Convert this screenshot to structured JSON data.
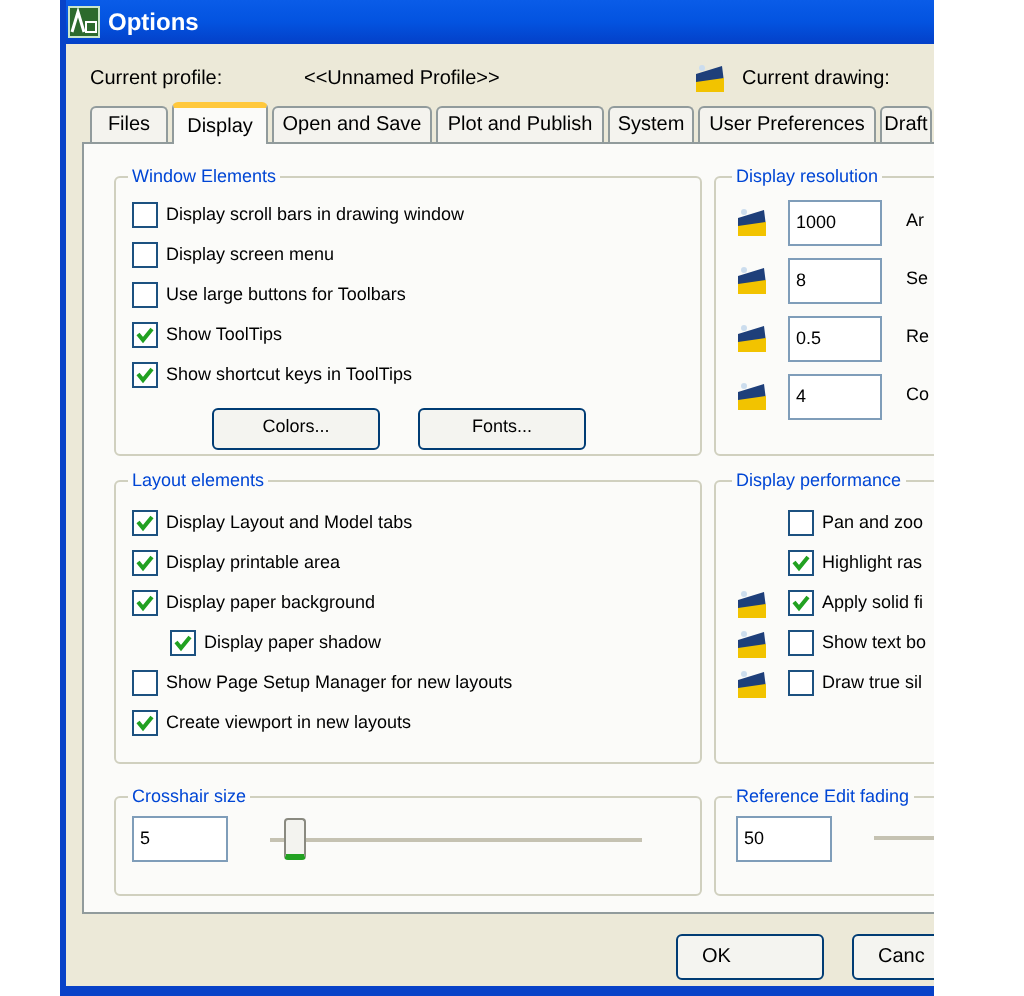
{
  "window": {
    "title": "Options"
  },
  "profile": {
    "current_profile_label": "Current profile:",
    "current_profile": "<<Unnamed Profile>>",
    "current_drawing_label": "Current drawing:"
  },
  "tabs": [
    {
      "label": "Files",
      "selected": false
    },
    {
      "label": "Display",
      "selected": true
    },
    {
      "label": "Open and Save",
      "selected": false
    },
    {
      "label": "Plot and Publish",
      "selected": false
    },
    {
      "label": "System",
      "selected": false
    },
    {
      "label": "User Preferences",
      "selected": false
    },
    {
      "label": "Draft",
      "selected": false
    }
  ],
  "window_elements": {
    "title": "Window Elements",
    "options": [
      {
        "label": "Display scroll bars in drawing window",
        "checked": false
      },
      {
        "label": "Display screen menu",
        "checked": false
      },
      {
        "label": "Use large buttons for Toolbars",
        "checked": false
      },
      {
        "label": "Show ToolTips",
        "checked": true
      },
      {
        "label": "Show shortcut keys in ToolTips",
        "checked": true
      }
    ],
    "buttons": [
      "Colors...",
      "Fonts..."
    ]
  },
  "layout_elements": {
    "title": "Layout elements",
    "options": [
      {
        "label": "Display Layout and Model tabs",
        "checked": true
      },
      {
        "label": "Display printable area",
        "checked": true
      },
      {
        "label": "Display paper background",
        "checked": true,
        "children": [
          {
            "label": "Display paper shadow",
            "checked": true
          }
        ]
      },
      {
        "label": "Show Page Setup Manager for new layouts",
        "checked": false
      },
      {
        "label": "Create viewport in new layouts",
        "checked": true
      }
    ]
  },
  "crosshair_size": {
    "title": "Crosshair size",
    "value": "5",
    "level": 0.04
  },
  "display_resolution": {
    "title": "Display resolution",
    "fields": [
      {
        "value": "1000",
        "label": "Ar",
        "saved_in_drawing": true
      },
      {
        "value": "8",
        "label": "Se",
        "saved_in_drawing": true
      },
      {
        "value": "0.5",
        "label": "Re",
        "saved_in_drawing": true
      },
      {
        "value": "4",
        "label": "Co",
        "saved_in_drawing": true
      }
    ]
  },
  "display_performance": {
    "title": "Display performance",
    "options": [
      {
        "label": "Pan and zoo",
        "checked": false,
        "saved_in_drawing": false
      },
      {
        "label": "Highlight ras",
        "checked": true,
        "saved_in_drawing": false
      },
      {
        "label": "Apply solid fi",
        "checked": true,
        "saved_in_drawing": true
      },
      {
        "label": "Show text bo",
        "checked": false,
        "saved_in_drawing": true
      },
      {
        "label": "Draw true sil",
        "checked": false,
        "saved_in_drawing": true
      }
    ]
  },
  "reference_edit_fading": {
    "title": "Reference Edit fading",
    "value": "50"
  },
  "buttons": [
    "OK",
    "Canc"
  ]
}
